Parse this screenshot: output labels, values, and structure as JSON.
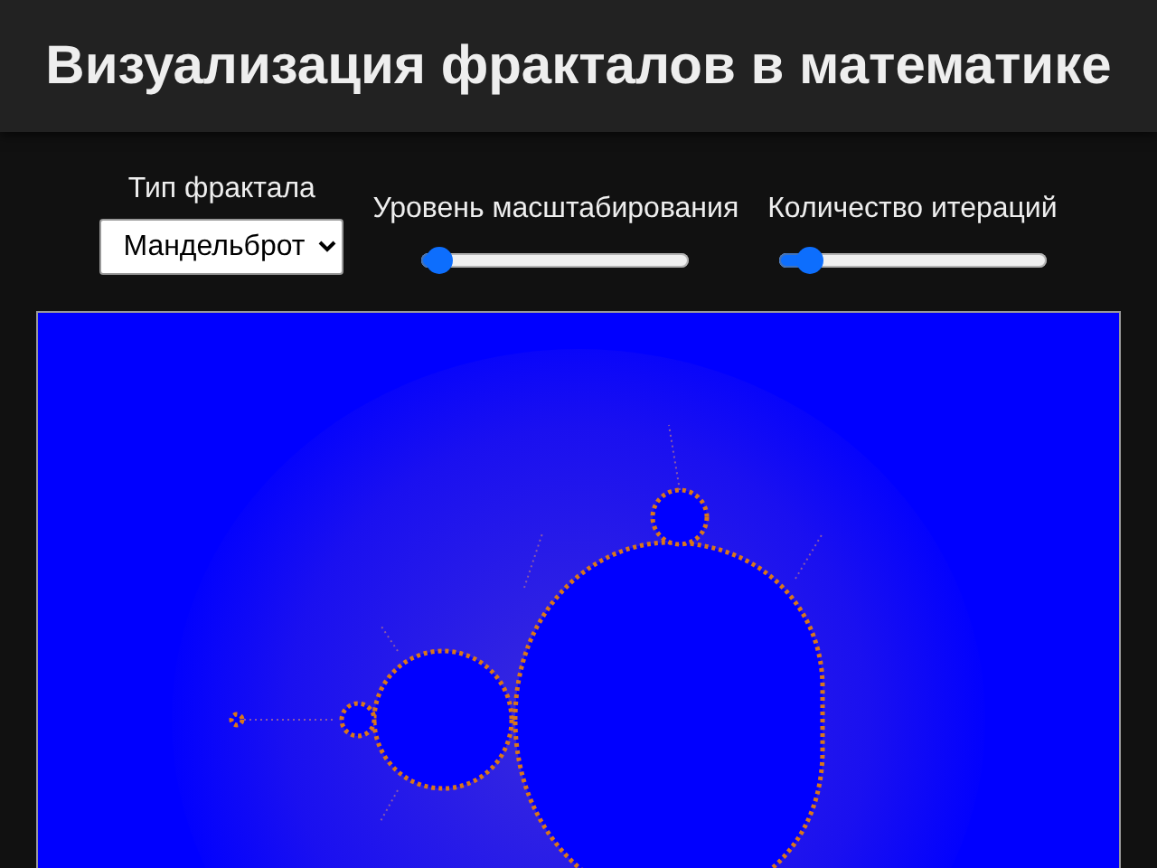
{
  "header": {
    "title": "Визуализация фракталов в математике"
  },
  "controls": [
    {
      "kind": "select",
      "label": "Тип фрактала",
      "value": "Мандельброт"
    },
    {
      "kind": "slider",
      "label": "Уровень масштабирования",
      "level": 0.02
    },
    {
      "kind": "slider",
      "label": "Количество итераций",
      "level": 0.08
    }
  ]
}
